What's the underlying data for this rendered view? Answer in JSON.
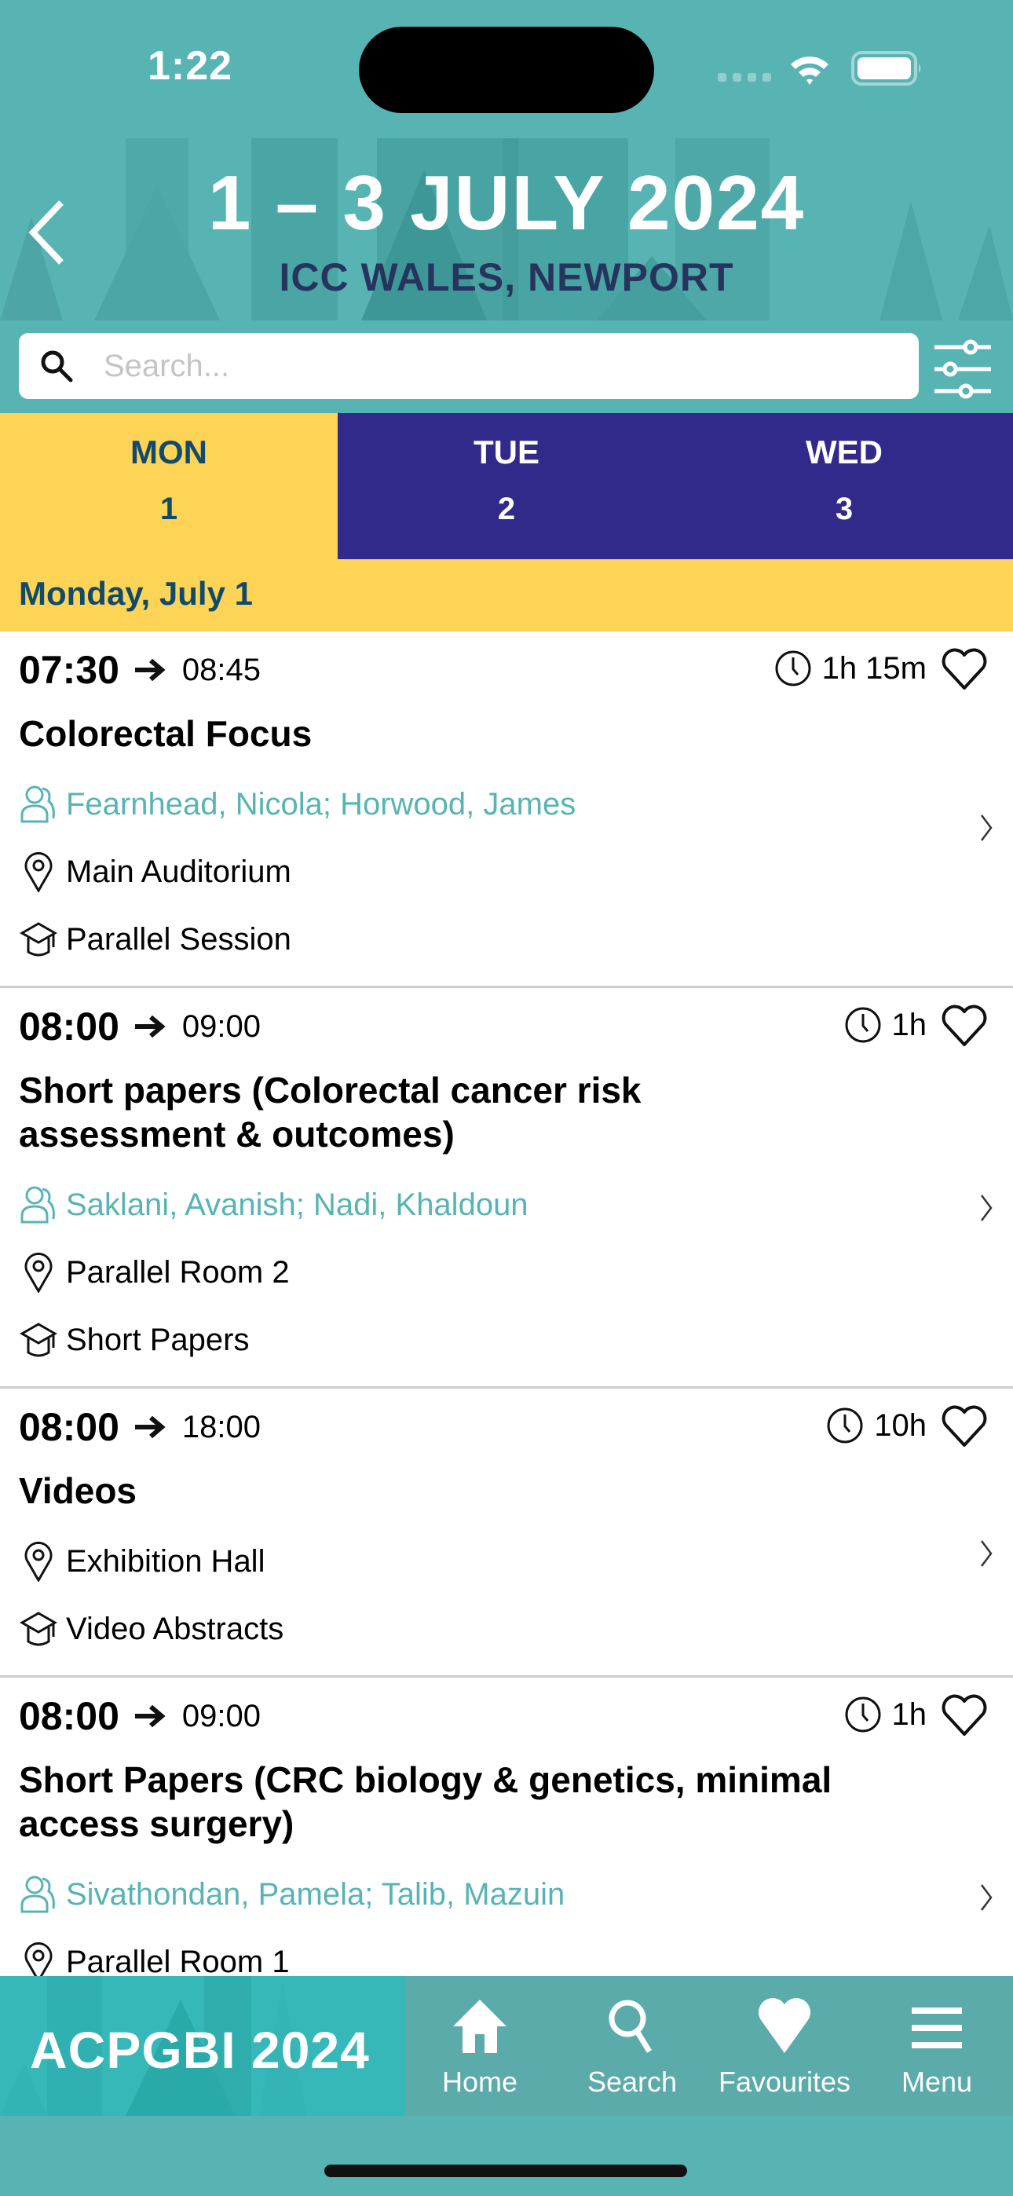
{
  "status_bar": {
    "time": "1:22"
  },
  "header": {
    "dates": "1 – 3 JULY 2024",
    "venue": "ICC WALES, NEWPORT"
  },
  "search": {
    "placeholder": "Search...",
    "value": ""
  },
  "day_tabs": [
    {
      "day": "MON",
      "date": "1",
      "active": true
    },
    {
      "day": "TUE",
      "date": "2",
      "active": false
    },
    {
      "day": "WED",
      "date": "3",
      "active": false
    }
  ],
  "date_header": "Monday, July 1",
  "sessions": [
    {
      "start": "07:30",
      "end": "08:45",
      "duration": "1h 15m",
      "title": "Colorectal Focus",
      "speakers": "Fearnhead, Nicola; Horwood, James",
      "location": "Main Auditorium",
      "type": "Parallel Session",
      "favourite": false
    },
    {
      "start": "08:00",
      "end": "09:00",
      "duration": "1h",
      "title": "Short papers (Colorectal cancer risk assessment & outcomes)",
      "speakers": "Saklani, Avanish; Nadi, Khaldoun",
      "location": "Parallel Room 2",
      "type": "Short Papers",
      "favourite": false
    },
    {
      "start": "08:00",
      "end": "18:00",
      "duration": "10h",
      "title": "Videos",
      "location": "Exhibition Hall",
      "type": "Video Abstracts",
      "favourite": false
    },
    {
      "start": "08:00",
      "end": "09:00",
      "duration": "1h",
      "title": "Short Papers (CRC biology & genetics, minimal access surgery)",
      "speakers": "Sivathondan, Pamela; Talib, Mazuin",
      "location": "Parallel Room 1",
      "favourite": false
    }
  ],
  "bottom_nav": {
    "brand": "ACPGBI 2024",
    "items": [
      {
        "label": "Home",
        "icon": "home-icon"
      },
      {
        "label": "Search",
        "icon": "search-icon"
      },
      {
        "label": "Favourites",
        "icon": "heart-icon"
      },
      {
        "label": "Menu",
        "icon": "menu-icon"
      }
    ]
  },
  "colors": {
    "teal": "#58b4b3",
    "yellow": "#fdd456",
    "navy": "#312a8b",
    "dark_blue_text": "#124a6e"
  }
}
